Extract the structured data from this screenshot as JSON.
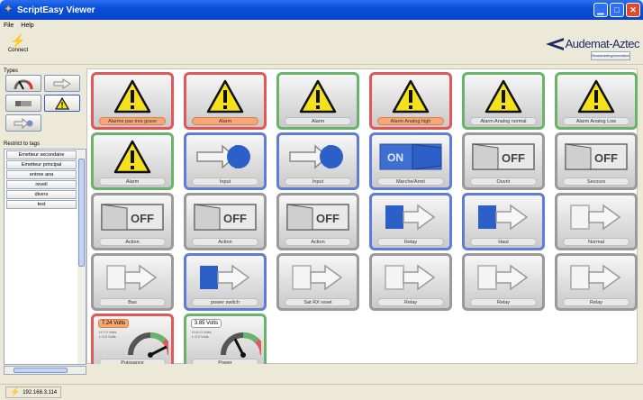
{
  "window": {
    "title": "ScriptEasy Viewer",
    "controls": [
      "minimize",
      "maximize",
      "close"
    ]
  },
  "menu": [
    "File",
    "Help"
  ],
  "toolbar": {
    "connect_label": "Connect",
    "logo_name": "Audemat-Aztec",
    "logo_tagline": "BroadcastingInnovation"
  },
  "sidebar": {
    "types_label": "Types",
    "types": [
      "gauge",
      "arrow",
      "slider",
      "warning",
      "input"
    ],
    "restrict_label": "Restrict to tags",
    "tags": [
      "Emetteur secondaire",
      "Emetteur principal",
      "entree ana",
      "reveil",
      "divers",
      "test"
    ]
  },
  "tiles": [
    {
      "icon": "warning",
      "label": "Alarme pas tres grave",
      "border": "red",
      "cap": "orange"
    },
    {
      "icon": "warning",
      "label": "Alarm",
      "border": "red",
      "cap": "orange"
    },
    {
      "icon": "warning",
      "label": "Alarm",
      "border": "green",
      "cap": "normal"
    },
    {
      "icon": "warning",
      "label": "Alarm Analog high",
      "border": "red",
      "cap": "orange"
    },
    {
      "icon": "warning",
      "label": "Alarm Analog normal",
      "border": "green",
      "cap": "normal"
    },
    {
      "icon": "warning",
      "label": "Alarm Analog Low",
      "border": "green",
      "cap": "normal"
    },
    {
      "icon": "warning",
      "label": "Alarm",
      "border": "green",
      "cap": "normal"
    },
    {
      "icon": "input",
      "label": "Input",
      "border": "blue",
      "cap": "normal"
    },
    {
      "icon": "input",
      "label": "Input",
      "border": "blue",
      "cap": "normal"
    },
    {
      "icon": "switch-on",
      "label": "Marche/Arret",
      "border": "blue",
      "cap": "normal"
    },
    {
      "icon": "switch-off",
      "label": "Ouvrir",
      "border": "gray",
      "cap": "normal"
    },
    {
      "icon": "switch-off",
      "label": "Secours",
      "border": "gray",
      "cap": "normal"
    },
    {
      "icon": "switch-off",
      "label": "Action",
      "border": "gray",
      "cap": "normal"
    },
    {
      "icon": "switch-off",
      "label": "Action",
      "border": "gray",
      "cap": "normal"
    },
    {
      "icon": "switch-off",
      "label": "Action",
      "border": "gray",
      "cap": "normal"
    },
    {
      "icon": "relay-on",
      "label": "Relay",
      "border": "blue",
      "cap": "normal"
    },
    {
      "icon": "relay-on",
      "label": "Haut",
      "border": "blue",
      "cap": "normal"
    },
    {
      "icon": "relay-off",
      "label": "Normal",
      "border": "gray",
      "cap": "normal"
    },
    {
      "icon": "relay-off",
      "label": "Bas",
      "border": "gray",
      "cap": "normal"
    },
    {
      "icon": "relay-on",
      "label": "power switch",
      "border": "blue",
      "cap": "normal"
    },
    {
      "icon": "relay-off",
      "label": "Sat RX reset",
      "border": "gray",
      "cap": "normal"
    },
    {
      "icon": "relay-off",
      "label": "Relay",
      "border": "gray",
      "cap": "normal"
    },
    {
      "icon": "relay-off",
      "label": "Relay",
      "border": "gray",
      "cap": "normal"
    },
    {
      "icon": "relay-off",
      "label": "Relay",
      "border": "gray",
      "cap": "normal"
    },
    {
      "icon": "gauge",
      "label": "Puissance",
      "border": "red",
      "cap": "normal",
      "value": "7.24 Volts",
      "value_style": "red",
      "sub1": "H:7.0 Volts",
      "sub2": "L:3.0 Volts",
      "level": 0.85
    },
    {
      "icon": "gauge",
      "label": "Power",
      "border": "green",
      "cap": "normal",
      "value": "3.85 Volts",
      "value_style": "normal",
      "sub1": "H:40.0 Volts",
      "sub2": "L:3.0 Volts",
      "level": 0.35
    }
  ],
  "status": {
    "ip": "192.168.3.114"
  },
  "colors": {
    "title_bar": "#0a4fd8",
    "red": "#e05858",
    "green": "#69b36a",
    "blue": "#5e7dd8",
    "relay_blue": "#2d5fc9",
    "warning_yellow": "#f5e11a"
  }
}
